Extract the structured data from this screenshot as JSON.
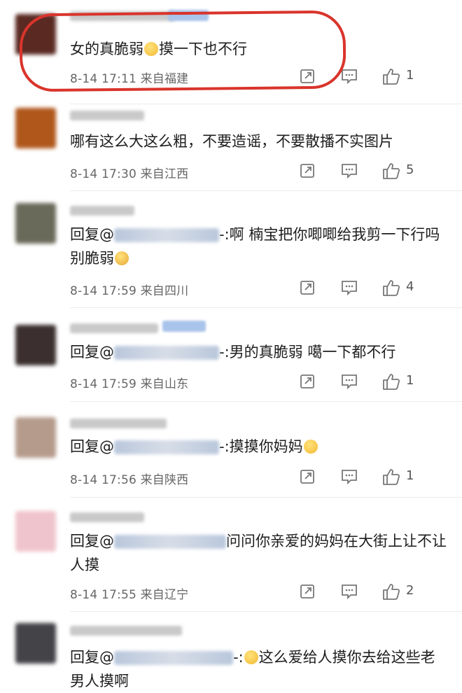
{
  "comments": [
    {
      "avatar_color": "#5a2a22",
      "text_before": "女的真脆弱",
      "mention": "",
      "text_after": "摸一下也不行",
      "has_emoji_mid": true,
      "meta": "8-14 17:11  来自福建",
      "likes": "1",
      "highlighted": true
    },
    {
      "avatar_color": "#b0571c",
      "text_before": "哪有这么大这么粗，不要造谣，不要散播不实图片",
      "meta": "8-14 17:30  来自江西",
      "likes": "5"
    },
    {
      "avatar_color": "#6a6a5a",
      "text_before": "回复@",
      "text_after": "-:啊  楠宝把你唧唧给我剪一下行吗  别脆弱",
      "meta": "8-14 17:59  来自四川",
      "likes": "4"
    },
    {
      "avatar_color": "#3b2f2f",
      "text_before": "回复@",
      "text_after": "-:男的真脆弱  噶一下都不行",
      "meta": "8-14 17:59  来自山东",
      "likes": "1"
    },
    {
      "avatar_color": "#b59b8c",
      "text_before": "回复@",
      "text_after": "-:摸摸你妈妈",
      "meta": "8-14 17:56  来自陕西",
      "likes": "1"
    },
    {
      "avatar_color": "#f0c4cc",
      "text_before": "回复@",
      "text_after": "问问你亲爱的妈妈在大街上让不让人摸",
      "meta": "8-14 17:55  来自辽宁",
      "likes": "2"
    },
    {
      "avatar_color": "#444448",
      "text_before": "回复@",
      "text_after": "这么爱给人摸你去给这些老男人摸啊",
      "meta": "",
      "likes": ""
    }
  ]
}
